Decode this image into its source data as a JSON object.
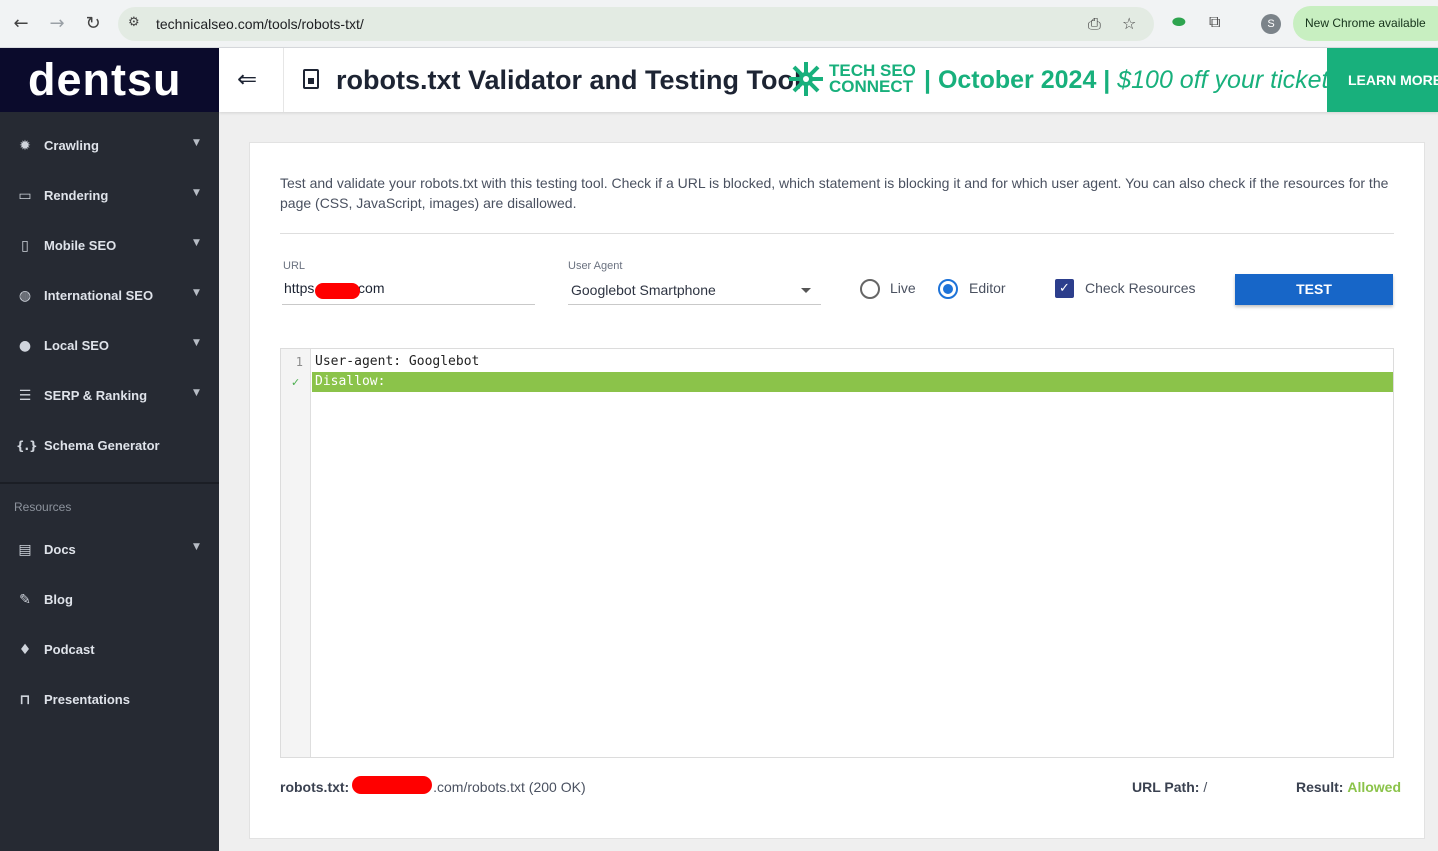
{
  "browser": {
    "url": "technicalseo.com/tools/robots-txt/",
    "profile_initial": "S",
    "update_label": "New Chrome available"
  },
  "sidebar": {
    "logo": "dentsu",
    "items": [
      {
        "label": "Crawling",
        "icon": "bug-icon"
      },
      {
        "label": "Rendering",
        "icon": "monitor-icon"
      },
      {
        "label": "Mobile SEO",
        "icon": "phone-icon"
      },
      {
        "label": "International SEO",
        "icon": "globe-icon"
      },
      {
        "label": "Local SEO",
        "icon": "map-pin-icon"
      },
      {
        "label": "SERP & Ranking",
        "icon": "list-icon"
      },
      {
        "label": "Schema Generator",
        "icon": "braces-icon"
      }
    ],
    "resources_heading": "Resources",
    "resource_items": [
      {
        "label": "Docs",
        "icon": "docs-icon"
      },
      {
        "label": "Blog",
        "icon": "pencil-icon"
      },
      {
        "label": "Podcast",
        "icon": "microphone-icon"
      },
      {
        "label": "Presentations",
        "icon": "presentation-icon"
      }
    ]
  },
  "header": {
    "title": "robots.txt Validator and Testing Tool",
    "banner_brand_line1": "TECH SEO",
    "banner_brand_line2": "CONNECT",
    "banner_date": "| October 2024 |",
    "banner_offer": "$100 off your ticket",
    "cta": "LEARN MORE",
    "accent_color": "#18b07c"
  },
  "tool": {
    "intro": "Test and validate your robots.txt with this testing tool. Check if a URL is blocked, which statement is blocking it and for which user agent. You can also check if the resources for the page (CSS, JavaScript, images) are disallowed.",
    "url_label": "URL",
    "url_prefix": "https",
    "url_suffix": "o.com",
    "ua_label": "User Agent",
    "ua_value": "Googlebot Smartphone",
    "mode_live": "Live",
    "mode_editor": "Editor",
    "selected_mode": "Editor",
    "check_resources": "Check Resources",
    "check_resources_checked": true,
    "test_button": "TEST",
    "editor_lines": [
      {
        "num": "1",
        "text": "User-agent: Googlebot"
      },
      {
        "num": "",
        "text": "Disallow:"
      }
    ],
    "footer": {
      "robots_label": "robots.txt:",
      "robots_value": ".com/robots.txt (200 OK)",
      "path_label": "URL Path:",
      "path_value": "/",
      "result_label": "Result:",
      "result_value": "Allowed",
      "result_color": "#8bc34a"
    }
  }
}
